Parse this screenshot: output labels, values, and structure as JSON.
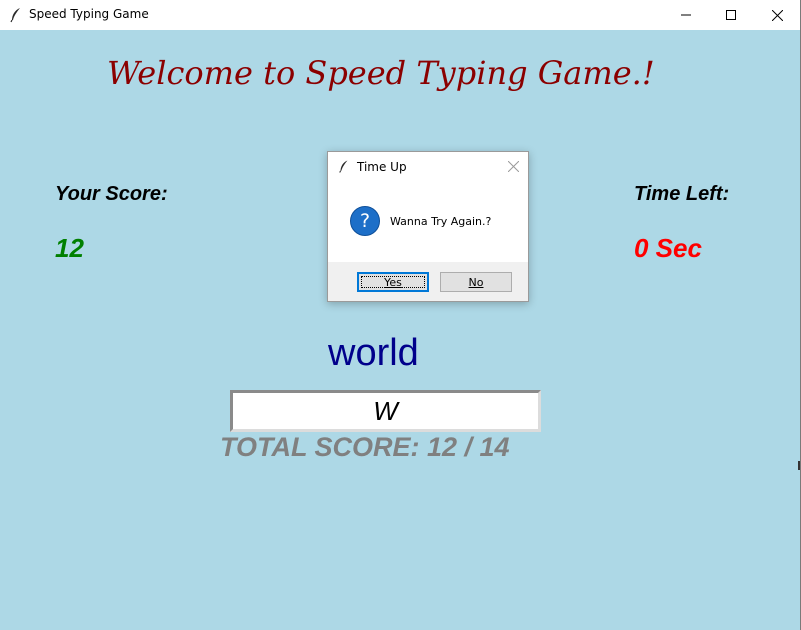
{
  "window": {
    "title": "Speed Typing Game",
    "icon": "feather-icon"
  },
  "game": {
    "welcome": "Welcome to Speed Typing Game.!",
    "score_label": "Your Score:",
    "score_value": "12",
    "time_label": "Time Left:",
    "time_value": "0 Sec",
    "word": "world",
    "entry_value": "W",
    "total_score": "TOTAL SCORE: 12 / 14"
  },
  "dialog": {
    "title": "Time Up",
    "message": "Wanna Try Again.?",
    "icon": "question-icon",
    "yes_label": "Yes",
    "no_label": "No"
  },
  "colors": {
    "background": "#add8e6",
    "welcome": "#8b0000",
    "score": "#008000",
    "time": "#ff0000",
    "word": "#00008b",
    "total": "#808080"
  }
}
